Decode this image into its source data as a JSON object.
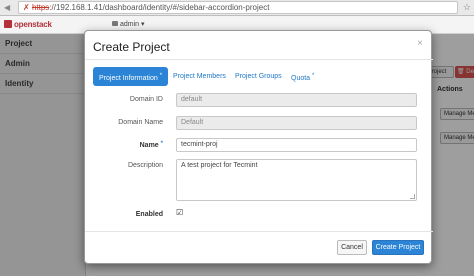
{
  "browser": {
    "url_protocol": "https",
    "url_rest": "://192.168.1.41/dashboard/identity/#/sidebar-accordion-project"
  },
  "app": {
    "logo_text": "openstack",
    "project_selector": "admin ▾"
  },
  "sidebar": {
    "items": [
      {
        "label": "Project"
      },
      {
        "label": "Admin"
      },
      {
        "label": "Identity"
      }
    ]
  },
  "background": {
    "create_button_fragment": "roject",
    "delete_button_fragment": "De",
    "actions_header": "Actions",
    "manage_buttons": [
      "Manage Me",
      "Manage Me"
    ]
  },
  "modal": {
    "title": "Create Project",
    "close_glyph": "×",
    "tabs": [
      {
        "label": "Project Information",
        "required": true,
        "active": true
      },
      {
        "label": "Project Members",
        "required": false,
        "active": false
      },
      {
        "label": "Project Groups",
        "required": false,
        "active": false
      },
      {
        "label": "Quota",
        "required": true,
        "active": false
      }
    ],
    "required_marker": "*",
    "fields": {
      "domain_id": {
        "label": "Domain ID",
        "value": "default"
      },
      "domain_name": {
        "label": "Domain Name",
        "value": "Default"
      },
      "name": {
        "label": "Name",
        "value": "tecmint-proj"
      },
      "description": {
        "label": "Description",
        "value": "A test project for Tecmint"
      },
      "enabled": {
        "label": "Enabled",
        "checked": true
      }
    },
    "cancel_label": "Cancel",
    "create_label": "Create Project"
  },
  "colors": {
    "accent": "#2b84d6",
    "brand": "#b3313a",
    "danger": "#d9534f"
  }
}
